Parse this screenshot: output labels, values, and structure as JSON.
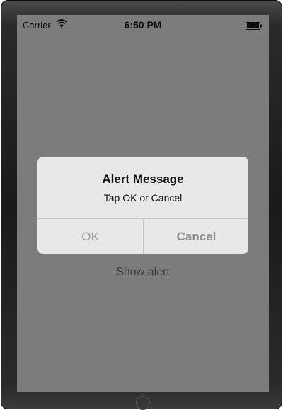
{
  "status_bar": {
    "carrier": "Carrier",
    "time": "6:50 PM",
    "wifi_icon": "wifi-icon",
    "battery_icon": "battery-icon"
  },
  "alert": {
    "title": "Alert Message",
    "message": "Tap OK or Cancel",
    "ok_label": "OK",
    "cancel_label": "Cancel"
  },
  "main": {
    "show_alert_label": "Show alert"
  },
  "colors": {
    "screen_background": "#7c7c7c",
    "alert_background": "#e8e8e8"
  }
}
